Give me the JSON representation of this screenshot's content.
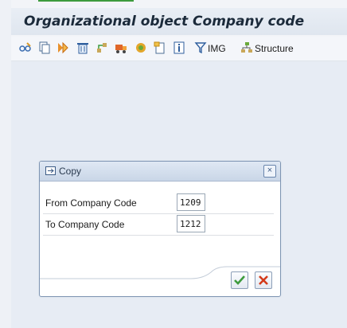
{
  "window": {
    "title": "Organizational object Company code"
  },
  "toolbar": {
    "img_label": "IMG",
    "structure_label": "Structure",
    "icons": [
      "edit-glasses-icon",
      "copy-org-object-icon",
      "transport-icon",
      "delete-icon",
      "check-icon",
      "transport-truck-icon",
      "settings-icon",
      "copy-doc-icon",
      "info-icon",
      "img-filter-icon",
      "structure-icon"
    ]
  },
  "dialog": {
    "title": "Copy",
    "fields": [
      {
        "label": "From Company Code",
        "value": "1209"
      },
      {
        "label": "To Company Code",
        "value": "1212"
      }
    ],
    "close_symbol": "×"
  },
  "colors": {
    "accent_green": "#3d9b3d",
    "cancel_red": "#d33a1a",
    "dialog_border": "#7f95b3"
  }
}
